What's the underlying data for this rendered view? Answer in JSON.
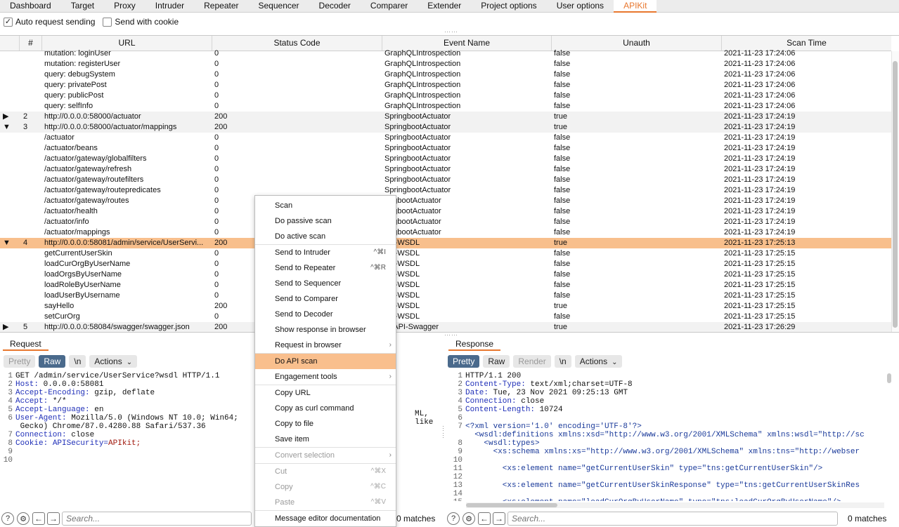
{
  "tabs": [
    "Dashboard",
    "Target",
    "Proxy",
    "Intruder",
    "Repeater",
    "Sequencer",
    "Decoder",
    "Comparer",
    "Extender",
    "Project options",
    "User options",
    "APIKit"
  ],
  "active_tab": "APIKit",
  "options": {
    "auto_request": "Auto request sending",
    "auto_request_checked": "✓",
    "send_cookie": "Send with cookie"
  },
  "table": {
    "headers": [
      "#",
      "URL",
      "Status Code",
      "Event Name",
      "Unauth",
      "Scan Time"
    ],
    "rows": [
      {
        "tw": "",
        "n": "",
        "url": "mutation: loginUser",
        "code": "0",
        "event": "GraphQLIntrospection",
        "unauth": "false",
        "time": "2021-11-23 17:24:06"
      },
      {
        "tw": "",
        "n": "",
        "url": "mutation: registerUser",
        "code": "0",
        "event": "GraphQLIntrospection",
        "unauth": "false",
        "time": "2021-11-23 17:24:06"
      },
      {
        "tw": "",
        "n": "",
        "url": "query: debugSystem",
        "code": "0",
        "event": "GraphQLIntrospection",
        "unauth": "false",
        "time": "2021-11-23 17:24:06"
      },
      {
        "tw": "",
        "n": "",
        "url": "query: privatePost",
        "code": "0",
        "event": "GraphQLIntrospection",
        "unauth": "false",
        "time": "2021-11-23 17:24:06"
      },
      {
        "tw": "",
        "n": "",
        "url": "query: publicPost",
        "code": "0",
        "event": "GraphQLIntrospection",
        "unauth": "false",
        "time": "2021-11-23 17:24:06"
      },
      {
        "tw": "",
        "n": "",
        "url": "query: selfInfo",
        "code": "0",
        "event": "GraphQLIntrospection",
        "unauth": "false",
        "time": "2021-11-23 17:24:06"
      },
      {
        "tw": "▶",
        "n": "2",
        "url": "http://0.0.0.0:58000/actuator",
        "code": "200",
        "event": "SpringbootActuator",
        "unauth": "true",
        "time": "2021-11-23 17:24:19"
      },
      {
        "tw": "▼",
        "n": "3",
        "url": "http://0.0.0.0:58000/actuator/mappings",
        "code": "200",
        "event": "SpringbootActuator",
        "unauth": "true",
        "time": "2021-11-23 17:24:19"
      },
      {
        "tw": "",
        "n": "",
        "url": "/actuator",
        "code": "0",
        "event": "SpringbootActuator",
        "unauth": "false",
        "time": "2021-11-23 17:24:19"
      },
      {
        "tw": "",
        "n": "",
        "url": "/actuator/beans",
        "code": "0",
        "event": "SpringbootActuator",
        "unauth": "false",
        "time": "2021-11-23 17:24:19"
      },
      {
        "tw": "",
        "n": "",
        "url": "/actuator/gateway/globalfilters",
        "code": "0",
        "event": "SpringbootActuator",
        "unauth": "false",
        "time": "2021-11-23 17:24:19"
      },
      {
        "tw": "",
        "n": "",
        "url": "/actuator/gateway/refresh",
        "code": "0",
        "event": "SpringbootActuator",
        "unauth": "false",
        "time": "2021-11-23 17:24:19"
      },
      {
        "tw": "",
        "n": "",
        "url": "/actuator/gateway/routefilters",
        "code": "0",
        "event": "SpringbootActuator",
        "unauth": "false",
        "time": "2021-11-23 17:24:19"
      },
      {
        "tw": "",
        "n": "",
        "url": "/actuator/gateway/routepredicates",
        "code": "0",
        "event": "SpringbootActuator",
        "unauth": "false",
        "time": "2021-11-23 17:24:19"
      },
      {
        "tw": "",
        "n": "",
        "url": "/actuator/gateway/routes",
        "code": "0",
        "event": "ringbootActuator",
        "unauth": "false",
        "time": "2021-11-23 17:24:19"
      },
      {
        "tw": "",
        "n": "",
        "url": "/actuator/health",
        "code": "0",
        "event": "ringbootActuator",
        "unauth": "false",
        "time": "2021-11-23 17:24:19"
      },
      {
        "tw": "",
        "n": "",
        "url": "/actuator/info",
        "code": "0",
        "event": "ringbootActuator",
        "unauth": "false",
        "time": "2021-11-23 17:24:19"
      },
      {
        "tw": "",
        "n": "",
        "url": "/actuator/mappings",
        "code": "0",
        "event": "ringbootActuator",
        "unauth": "false",
        "time": "2021-11-23 17:24:19"
      },
      {
        "tw": "▼",
        "n": "4",
        "url": "http://0.0.0.0:58081/admin/service/UserServi...",
        "code": "200",
        "event": "AP-WSDL",
        "unauth": "true",
        "time": "2021-11-23 17:25:13"
      },
      {
        "tw": "",
        "n": "",
        "url": "getCurrentUserSkin",
        "code": "0",
        "event": "AP-WSDL",
        "unauth": "false",
        "time": "2021-11-23 17:25:15"
      },
      {
        "tw": "",
        "n": "",
        "url": "loadCurOrgByUserName",
        "code": "0",
        "event": "AP-WSDL",
        "unauth": "false",
        "time": "2021-11-23 17:25:15"
      },
      {
        "tw": "",
        "n": "",
        "url": "loadOrgsByUserName",
        "code": "0",
        "event": "AP-WSDL",
        "unauth": "false",
        "time": "2021-11-23 17:25:15"
      },
      {
        "tw": "",
        "n": "",
        "url": "loadRoleByUserName",
        "code": "0",
        "event": "AP-WSDL",
        "unauth": "false",
        "time": "2021-11-23 17:25:15"
      },
      {
        "tw": "",
        "n": "",
        "url": "loadUserByUsername",
        "code": "0",
        "event": "AP-WSDL",
        "unauth": "false",
        "time": "2021-11-23 17:25:15"
      },
      {
        "tw": "",
        "n": "",
        "url": "sayHello",
        "code": "200",
        "event": "AP-WSDL",
        "unauth": "true",
        "time": "2021-11-23 17:25:15"
      },
      {
        "tw": "",
        "n": "",
        "url": "setCurOrg",
        "code": "0",
        "event": "AP-WSDL",
        "unauth": "false",
        "time": "2021-11-23 17:25:15"
      },
      {
        "tw": "▶",
        "n": "5",
        "url": "http://0.0.0.0:58084/swagger/swagger.json",
        "code": "200",
        "event": "enAPI-Swagger",
        "unauth": "true",
        "time": "2021-11-23 17:26:29"
      }
    ]
  },
  "request": {
    "title": "Request",
    "buttons": [
      "Pretty",
      "Raw",
      "\\n",
      "Actions"
    ],
    "lines": [
      "GET /admin/service/UserService?wsdl HTTP/1.1",
      "Host: 0.0.0.0:58081",
      "Accept-Encoding: gzip, deflate",
      "Accept: */*",
      "Accept-Language: en",
      "User-Agent: Mozilla/5.0 (Windows NT 10.0; Win64;",
      " Gecko) Chrome/87.0.4280.88 Safari/537.36",
      "Connection: close",
      "Cookie: APISecurity=APIkit;",
      "",
      ""
    ],
    "ua_tail": "ML, like",
    "search_placeholder": "Search...",
    "matches": "0 matches"
  },
  "response": {
    "title": "Response",
    "buttons": [
      "Pretty",
      "Raw",
      "Render",
      "\\n",
      "Actions"
    ],
    "lines": [
      "HTTP/1.1 200",
      "Content-Type: text/xml;charset=UTF-8",
      "Date: Tue, 23 Nov 2021 09:25:13 GMT",
      "Connection: close",
      "Content-Length: 10724",
      "",
      "<?xml version='1.0' encoding='UTF-8'?>",
      "  <wsdl:definitions xmlns:xsd=\"http://www.w3.org/2001/XMLSchema\" xmlns:wsdl=\"http://sc",
      "    <wsdl:types>",
      "      <xs:schema xmlns:xs=\"http://www.w3.org/2001/XMLSchema\" xmlns:tns=\"http://webser",
      "",
      "        <xs:element name=\"getCurrentUserSkin\" type=\"tns:getCurrentUserSkin\"/>",
      "",
      "        <xs:element name=\"getCurrentUserSkinResponse\" type=\"tns:getCurrentUserSkinRes",
      "",
      "        <xs:element name=\"loadCurOrgByUserName\" type=\"tns:loadCurOrgByUserName\"/>"
    ],
    "gutter": [
      "1",
      "2",
      "3",
      "4",
      "5",
      "6",
      "7",
      "8",
      "9",
      "10",
      "11",
      "12",
      "13",
      "14",
      "15"
    ],
    "search_placeholder": "Search...",
    "matches": "0 matches"
  },
  "context_menu": {
    "items": [
      {
        "label": "Scan",
        "shortcut": "",
        "sub": false,
        "disabled": false,
        "hl": false
      },
      {
        "label": "Do passive scan",
        "shortcut": "",
        "sub": false,
        "disabled": false,
        "hl": false
      },
      {
        "label": "Do active scan",
        "shortcut": "",
        "sub": false,
        "disabled": false,
        "hl": false
      },
      {
        "label": "Send to Intruder",
        "shortcut": "^⌘I",
        "sub": false,
        "disabled": false,
        "hl": false
      },
      {
        "label": "Send to Repeater",
        "shortcut": "^⌘R",
        "sub": false,
        "disabled": false,
        "hl": false
      },
      {
        "label": "Send to Sequencer",
        "shortcut": "",
        "sub": false,
        "disabled": false,
        "hl": false
      },
      {
        "label": "Send to Comparer",
        "shortcut": "",
        "sub": false,
        "disabled": false,
        "hl": false
      },
      {
        "label": "Send to Decoder",
        "shortcut": "",
        "sub": false,
        "disabled": false,
        "hl": false
      },
      {
        "label": "Show response in browser",
        "shortcut": "",
        "sub": false,
        "disabled": false,
        "hl": false
      },
      {
        "label": "Request in browser",
        "shortcut": "",
        "sub": true,
        "disabled": false,
        "hl": false
      },
      {
        "label": "Do API scan",
        "shortcut": "",
        "sub": false,
        "disabled": false,
        "hl": true
      },
      {
        "label": "Engagement tools",
        "shortcut": "",
        "sub": true,
        "disabled": false,
        "hl": false
      },
      {
        "label": "Copy URL",
        "shortcut": "",
        "sub": false,
        "disabled": false,
        "hl": false
      },
      {
        "label": "Copy as curl command",
        "shortcut": "",
        "sub": false,
        "disabled": false,
        "hl": false
      },
      {
        "label": "Copy to file",
        "shortcut": "",
        "sub": false,
        "disabled": false,
        "hl": false
      },
      {
        "label": "Save item",
        "shortcut": "",
        "sub": false,
        "disabled": false,
        "hl": false
      },
      {
        "label": "Convert selection",
        "shortcut": "",
        "sub": true,
        "disabled": true,
        "hl": false
      },
      {
        "label": "Cut",
        "shortcut": "^⌘X",
        "sub": false,
        "disabled": true,
        "hl": false
      },
      {
        "label": "Copy",
        "shortcut": "^⌘C",
        "sub": false,
        "disabled": true,
        "hl": false
      },
      {
        "label": "Paste",
        "shortcut": "^⌘V",
        "sub": false,
        "disabled": true,
        "hl": false
      },
      {
        "label": "Message editor documentation",
        "shortcut": "",
        "sub": false,
        "disabled": false,
        "hl": false
      }
    ]
  },
  "colors": {
    "accent": "#e8772e",
    "selected_row": "#f8bf8c",
    "menu_highlight": "#f9bf8d",
    "button_on": "#4a6a8c"
  }
}
